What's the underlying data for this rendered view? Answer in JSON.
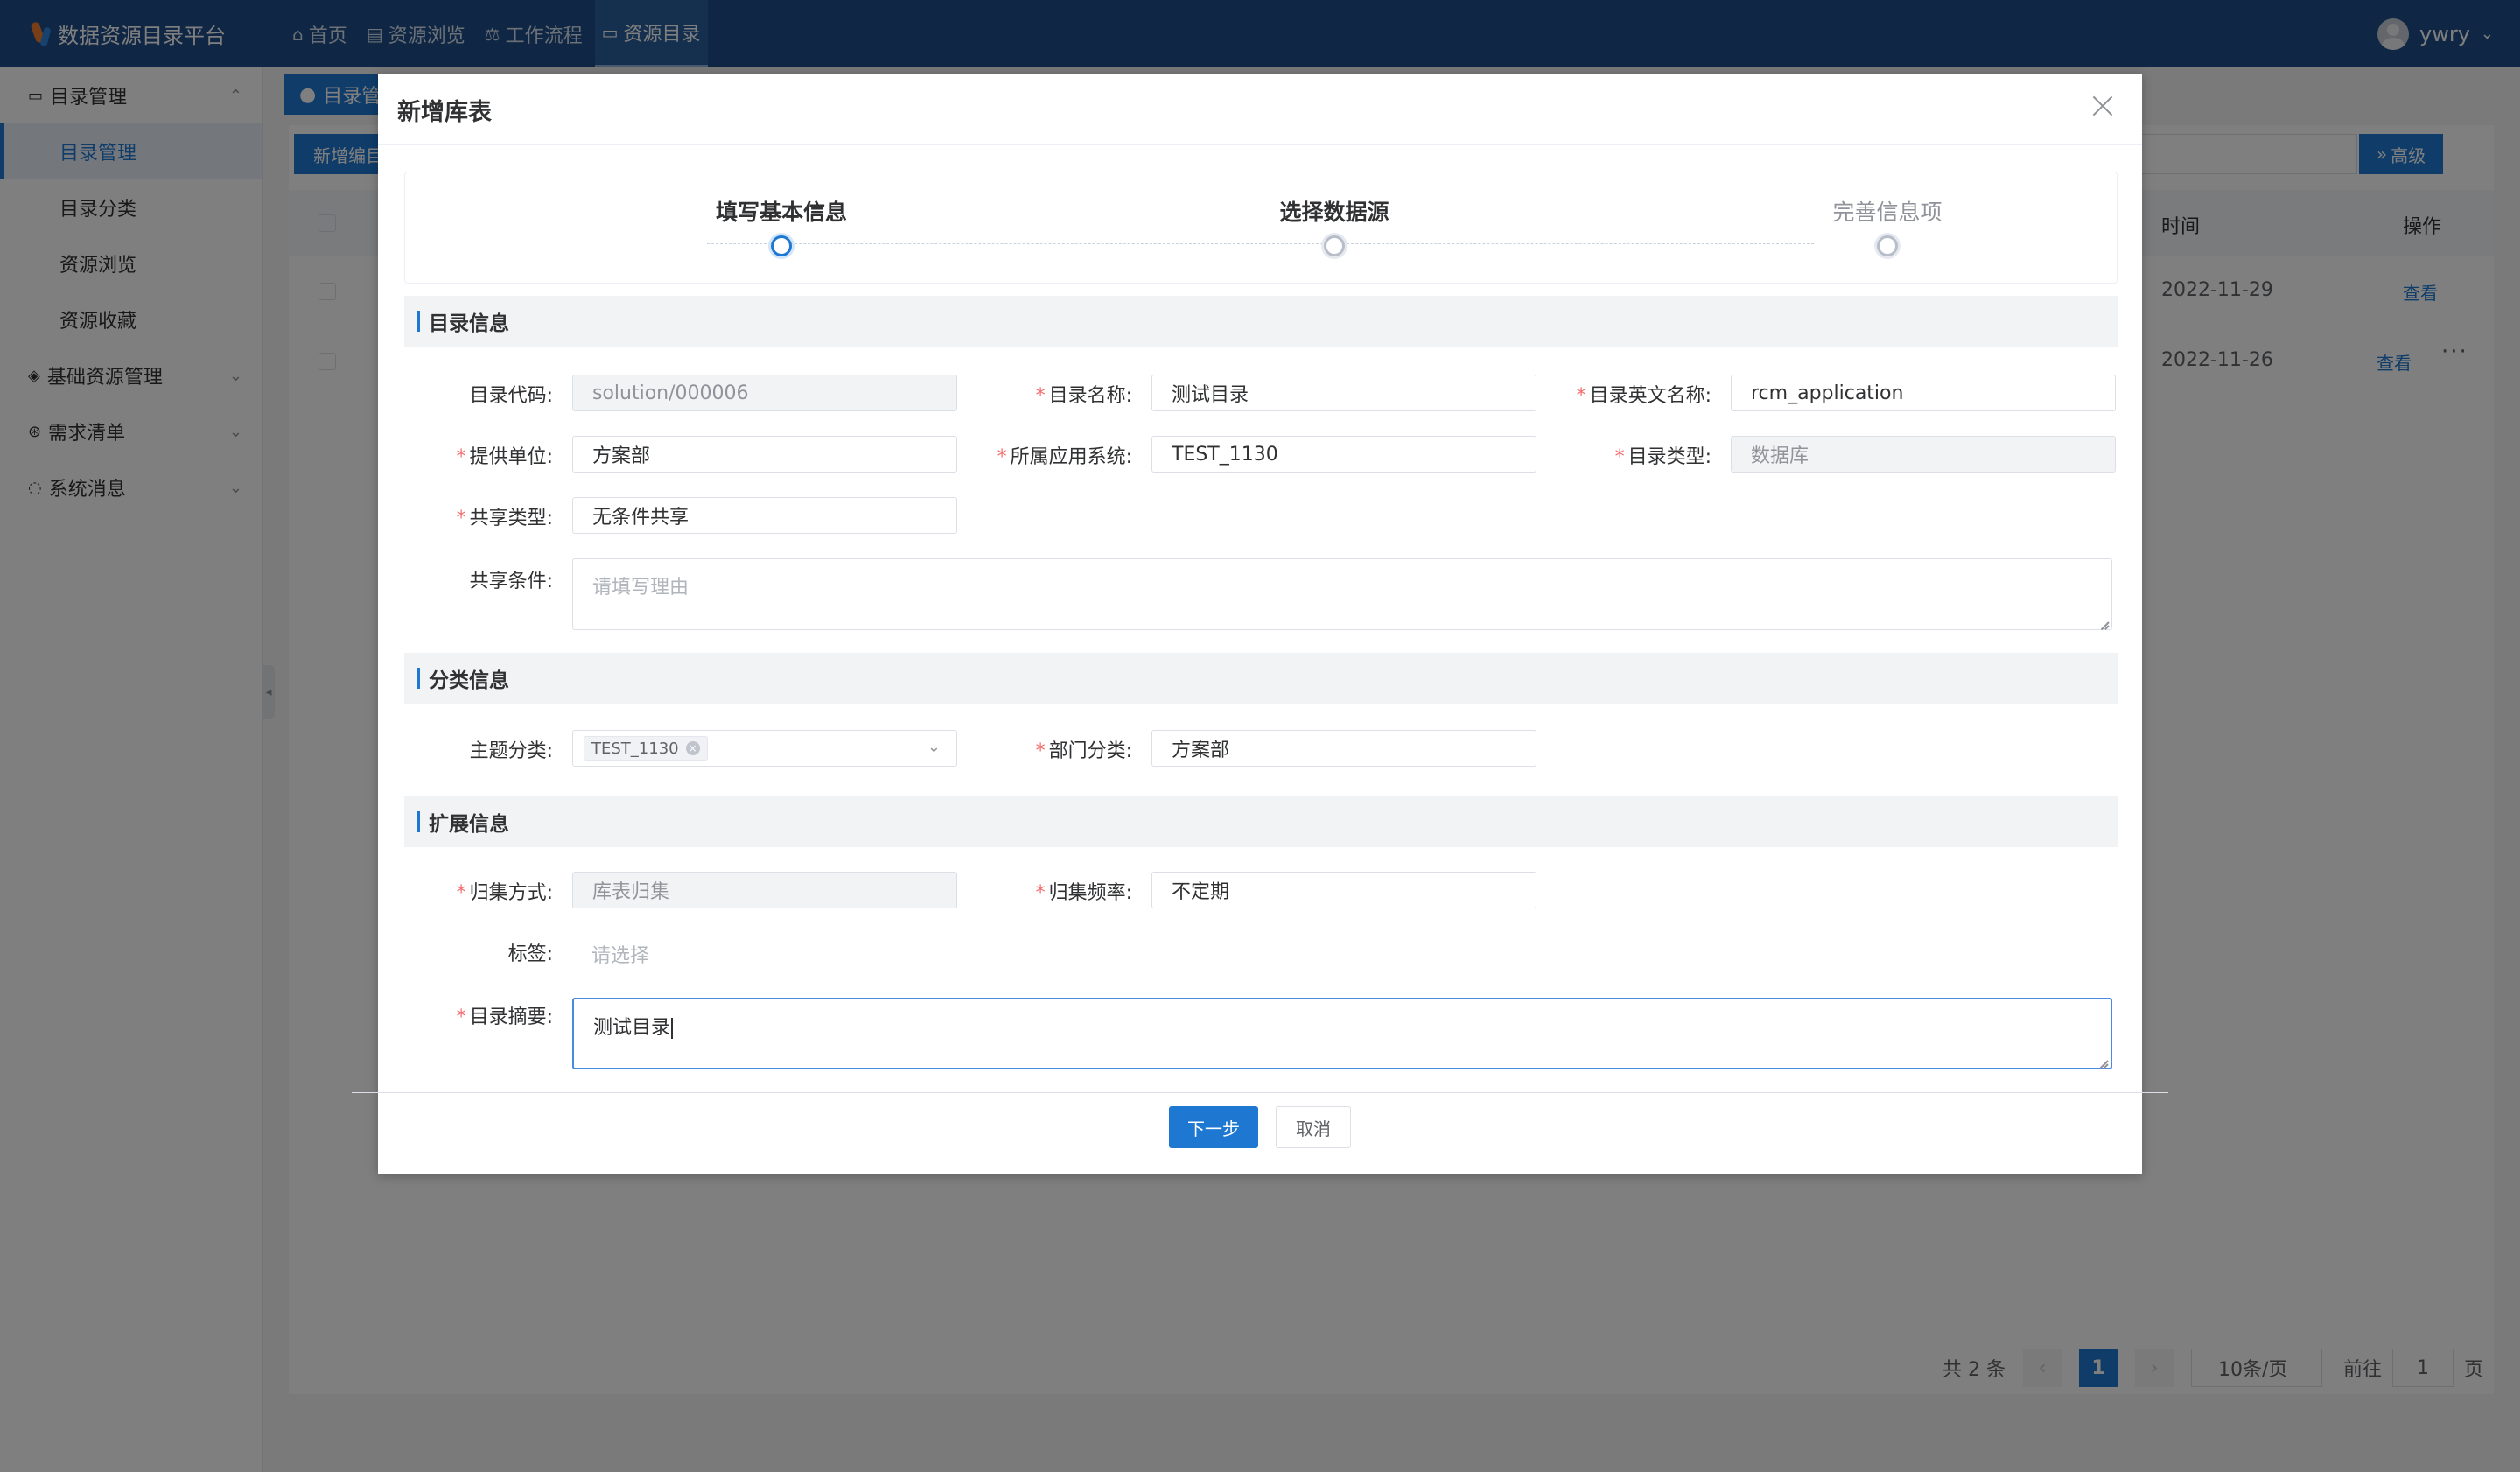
{
  "app": {
    "title": "数据资源目录平台"
  },
  "nav": [
    {
      "label": "首页",
      "icon": "home-icon"
    },
    {
      "label": "资源浏览",
      "icon": "book-icon"
    },
    {
      "label": "工作流程",
      "icon": "workflow-icon"
    },
    {
      "label": "资源目录",
      "icon": "folder-icon",
      "active": true
    }
  ],
  "user": {
    "name": "ywry"
  },
  "sidebar": {
    "group_catalog": "目录管理",
    "items": [
      "目录管理",
      "目录分类",
      "资源浏览",
      "资源收藏"
    ],
    "group_basic": "基础资源管理",
    "group_demand": "需求清单",
    "group_message": "系统消息"
  },
  "background": {
    "tab_label": "目录管",
    "new_button": "新增编目",
    "advanced_button": "高级",
    "col_time": "时间",
    "col_op": "操作",
    "rows": [
      {
        "time": "2022-11-29",
        "link": "查看"
      },
      {
        "time": "2022-11-26",
        "link": "查看"
      }
    ],
    "pager": {
      "total": "共 2 条",
      "current": "1",
      "size": "10条/页",
      "goto_label": "前往",
      "goto_value": "1",
      "page_unit": "页"
    }
  },
  "dialog": {
    "title": "新增库表",
    "steps": [
      "填写基本信息",
      "选择数据源",
      "完善信息项"
    ],
    "sections": {
      "catalog": "目录信息",
      "classify": "分类信息",
      "extend": "扩展信息"
    },
    "fields": {
      "code": {
        "label": "目录代码:",
        "value": "solution/000006"
      },
      "name": {
        "label": "目录名称:",
        "value": "测试目录"
      },
      "en_name": {
        "label": "目录英文名称:",
        "value": "rcm_application"
      },
      "provider": {
        "label": "提供单位:",
        "value": "方案部"
      },
      "app_system": {
        "label": "所属应用系统:",
        "value": "TEST_1130"
      },
      "type": {
        "label": "目录类型:",
        "value": "数据库"
      },
      "share_type": {
        "label": "共享类型:",
        "value": "无条件共享"
      },
      "share_cond": {
        "label": "共享条件:",
        "placeholder": "请填写理由"
      },
      "topic": {
        "label": "主题分类:",
        "chip": "TEST_1130"
      },
      "dept": {
        "label": "部门分类:",
        "value": "方案部"
      },
      "collect_method": {
        "label": "归集方式:",
        "value": "库表归集"
      },
      "collect_freq": {
        "label": "归集频率:",
        "value": "不定期"
      },
      "tags": {
        "label": "标签:",
        "placeholder": "请选择"
      },
      "summary": {
        "label": "目录摘要:",
        "value": "测试目录"
      }
    },
    "required_mark": "*",
    "buttons": {
      "next": "下一步",
      "cancel": "取消"
    }
  }
}
